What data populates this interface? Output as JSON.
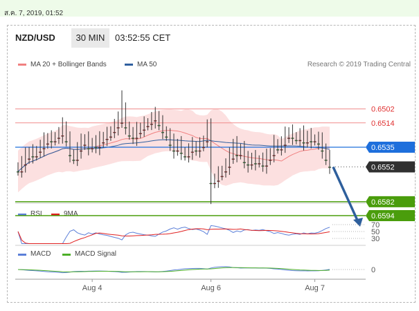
{
  "datetime": "ส.ค. 7, 2019, 01:52",
  "header": {
    "pair": "NZD/USD",
    "timeframe": "30 MIN",
    "clock": "03:52:55 CET"
  },
  "legend": {
    "items": [
      {
        "label": "MA 20 + Bollinger Bands",
        "color": "#f08080"
      },
      {
        "label": "MA 50",
        "color": "#2f5f9f"
      }
    ],
    "credit": "Research © 2019 Trading Central"
  },
  "price_levels": [
    {
      "value": "0.6594",
      "role": "resistance",
      "bg": "#4a9d0c",
      "fg": "#ffffff"
    },
    {
      "value": "0.6582",
      "role": "resistance",
      "bg": "#4a9d0c",
      "fg": "#ffffff"
    },
    {
      "value": "0.6552",
      "role": "last",
      "bg": "#303030",
      "fg": "#ffffff"
    },
    {
      "value": "0.6535",
      "role": "pivot",
      "bg": "#1e6fdc",
      "fg": "#ffffff"
    },
    {
      "value": "0.6514",
      "role": "support",
      "bg": "",
      "fg": "#e03030"
    },
    {
      "value": "0.6502",
      "role": "support",
      "bg": "",
      "fg": "#e03030"
    }
  ],
  "rsi": {
    "legend": [
      {
        "label": "RSI",
        "color": "#5b7fd8"
      },
      {
        "label": "9MA",
        "color": "#e02020"
      }
    ],
    "levels": [
      "70",
      "50",
      "30"
    ]
  },
  "macd": {
    "legend": [
      {
        "label": "MACD",
        "color": "#5b7fd8"
      },
      {
        "label": "MACD Signal",
        "color": "#4caf28"
      }
    ],
    "zero": "0"
  },
  "x_axis": [
    "Aug 4",
    "Aug 6",
    "Aug 7"
  ],
  "chart_data": {
    "type": "candlestick",
    "symbol": "NZD/USD",
    "interval": "30 MIN",
    "y_range": [
      0.648,
      0.662
    ],
    "x_ticks": [
      "Aug 4",
      "Aug 6",
      "Aug 7"
    ],
    "closes": [
      0.6556,
      0.655,
      0.6545,
      0.6541,
      0.6543,
      0.6539,
      0.6536,
      0.6532,
      0.6529,
      0.653,
      0.6527,
      0.6525,
      0.6519,
      0.653,
      0.6542,
      0.6546,
      0.6538,
      0.6533,
      0.653,
      0.6536,
      0.6532,
      0.6535,
      0.6531,
      0.6528,
      0.6526,
      0.6522,
      0.6518,
      0.6514,
      0.6505,
      0.6518,
      0.6525,
      0.6527,
      0.6523,
      0.652,
      0.6517,
      0.6515,
      0.6512,
      0.651,
      0.6516,
      0.6522,
      0.6526,
      0.6533,
      0.6538,
      0.6534,
      0.654,
      0.6543,
      0.6539,
      0.6536,
      0.6538,
      0.6535,
      0.653,
      0.652,
      0.6566,
      0.6564,
      0.656,
      0.6556,
      0.6552,
      0.6545,
      0.6534,
      0.6542,
      0.6537,
      0.6548,
      0.655,
      0.6546,
      0.6549,
      0.6547,
      0.6551,
      0.6546,
      0.6542,
      0.6533,
      0.6537,
      0.6533,
      0.6527,
      0.6524,
      0.6527,
      0.6529,
      0.6526,
      0.6531,
      0.6527,
      0.653,
      0.6529,
      0.6532,
      0.6538,
      0.6546,
      0.6552
    ]
  }
}
